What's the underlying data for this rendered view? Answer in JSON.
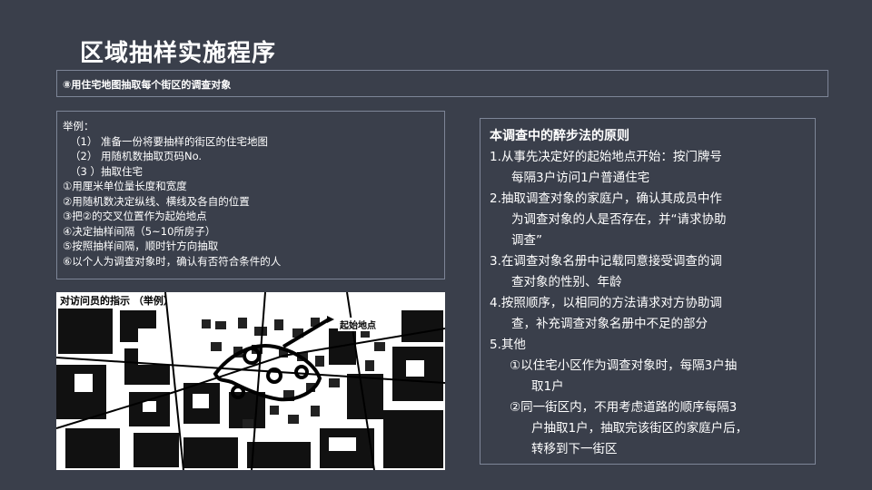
{
  "title": "区域抽样实施程序",
  "subtitle": "⑧用住宅地图抽取每个街区的调查对象",
  "example": {
    "heading": "举例：",
    "lines": [
      "（1）   准备一份将要抽样的街区的住宅地图",
      "（2）   用随机数抽取页码No.",
      "（3 ）抽取住宅",
      "①用厘米单位量长度和宽度",
      "②用随机数决定纵线、横线及各自的位置",
      "③把②的交叉位置作为起始地点",
      "④决定抽样间隔（5~10所房子）",
      "⑤按照抽样间隔，顺时针方向抽取",
      "⑥以个人为调查对象时，确认有否符合条件的人"
    ]
  },
  "map": {
    "caption": "对访问员的指示 （举例）",
    "start_label": "起始地点"
  },
  "principles": {
    "heading": "本调查中的醉步法的原则",
    "items": [
      [
        "1.从事先决定好的起始地点开始：按门牌号",
        "每隔3户访问1户普通住宅"
      ],
      [
        "2.抽取调查对象的家庭户，确认其成员中作",
        "为调查对象的人是否存在，并“请求协助",
        "调查”"
      ],
      [
        "3.在调查对象名册中记载同意接受调查的调",
        "查对象的性别、年龄"
      ],
      [
        "4.按照顺序，以相同的方法请求对方协助调",
        "查，补充调查对象名册中不足的部分"
      ],
      [
        "5.其他"
      ]
    ],
    "sub_items": [
      [
        "①以住宅小区作为调查对象时，每隔3户抽",
        "取1户"
      ],
      [
        "②同一街区内，不用考虑道路的顺序每隔3",
        "户抽取1户，抽取完该街区的家庭户后，",
        "转移到下一街区"
      ]
    ]
  }
}
